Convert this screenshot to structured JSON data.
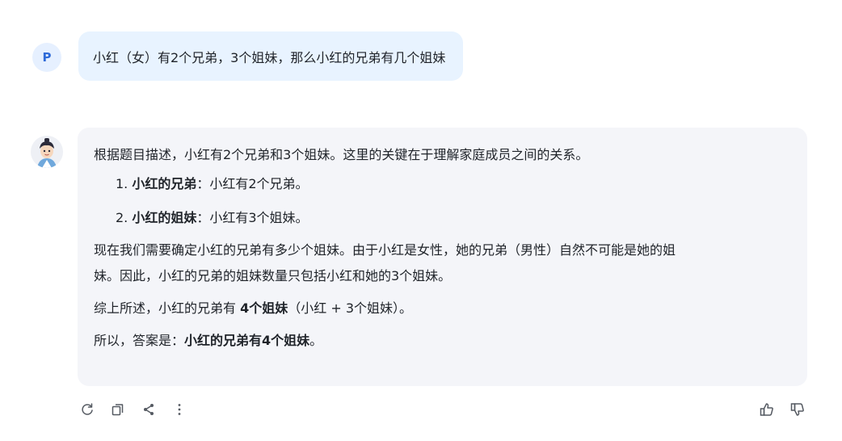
{
  "user": {
    "avatar_letter": "P",
    "message": "小红（女）有2个兄弟，3个姐妹，那么小红的兄弟有几个姐妹"
  },
  "assistant": {
    "intro": "根据题目描述，小红有2个兄弟和3个姐妹。这里的关键在于理解家庭成员之间的关系。",
    "list": [
      {
        "num": "1.",
        "bold": "小红的兄弟",
        "rest": "：小红有2个兄弟。"
      },
      {
        "num": "2.",
        "bold": "小红的姐妹",
        "rest": "：小红有3个姐妹。"
      }
    ],
    "para_line1": "现在我们需要确定小红的兄弟有多少个姐妹。由于小红是女性，她的兄弟（男性）自然不可能是她的姐",
    "para_line2": "妹。因此，小红的兄弟的姐妹数量只包括小红和她的3个姐妹。",
    "summary_prefix": "综上所述，小红的兄弟有 ",
    "summary_bold": "4个姐妹",
    "summary_suffix": "（小红 + 3个姐妹）。",
    "answer_prefix": "所以，答案是：",
    "answer_bold": "小红的兄弟有4个姐妹",
    "answer_suffix": "。"
  },
  "toolbar_icons": [
    "refresh-icon",
    "copy-icon",
    "share-icon",
    "more-icon",
    "thumbs-up-icon",
    "thumbs-down-icon"
  ],
  "colors": {
    "user_bubble": "#e8f3ff",
    "assistant_bubble": "#f4f5f9",
    "avatar_bg": "#e6f0ff",
    "avatar_text": "#2f6bd8",
    "icon": "#555a62"
  }
}
